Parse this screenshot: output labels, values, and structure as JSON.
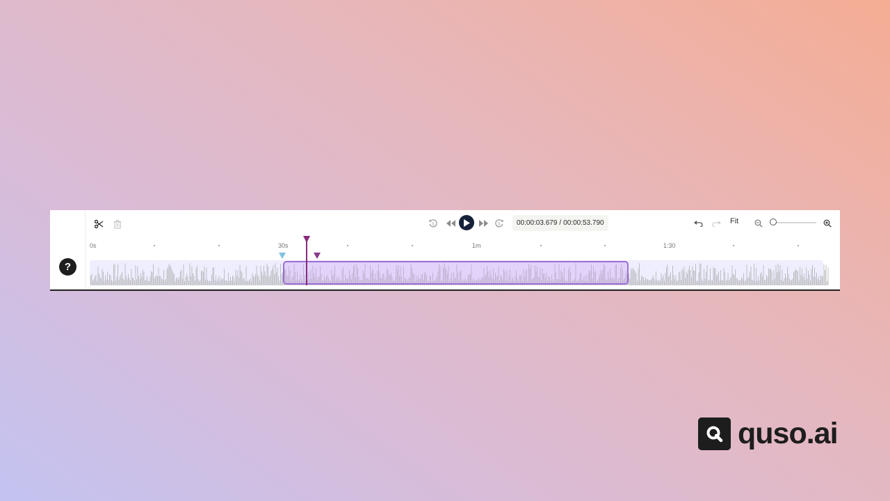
{
  "toolbar": {
    "help_label": "?",
    "current_time": "00:00:03.679",
    "separator": "/",
    "total_time": "00:00:53.790",
    "fit_label": "Fit",
    "zoom_level": 0.0,
    "icons": [
      "scissors-icon",
      "trash-icon",
      "rewind-5s-icon",
      "skip-back-icon",
      "play-icon",
      "skip-forward-icon",
      "forward-5s-icon",
      "undo-icon",
      "redo-icon",
      "zoom-out-icon",
      "zoom-in-icon"
    ]
  },
  "ruler": {
    "labels": [
      "0s",
      "30s",
      "1m",
      "1:30"
    ]
  },
  "colors": {
    "selection_border": "#9d6ed6",
    "playhead": "#8a2a7c",
    "start_marker": "#7fc2e0",
    "end_marker": "#8a3a8c",
    "waveform": "#bdbdc2"
  },
  "brand": {
    "name": "quso.ai"
  }
}
